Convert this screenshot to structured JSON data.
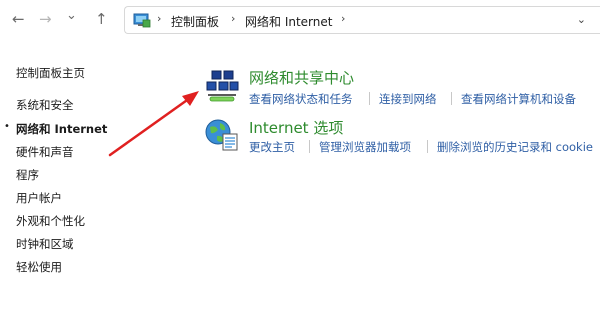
{
  "toolbar": {
    "back_icon": "←",
    "forward_icon": "→",
    "history_icon": "⌄",
    "up_icon": "↑"
  },
  "address_bar": {
    "crumbs": [
      "控制面板",
      "网络和 Internet"
    ],
    "separator": "›",
    "dropdown_icon": "⌄"
  },
  "sidebar": {
    "home": "控制面板主页",
    "items": [
      "系统和安全",
      "网络和 Internet",
      "硬件和声音",
      "程序",
      "用户帐户",
      "外观和个性化",
      "时钟和区域",
      "轻松使用"
    ],
    "active_index": 1,
    "bullet": "•"
  },
  "categories": [
    {
      "title": "网络和共享中心",
      "links": [
        "查看网络状态和任务",
        "连接到网络",
        "查看网络计算机和设备"
      ]
    },
    {
      "title": "Internet 选项",
      "links": [
        "更改主页",
        "管理浏览器加载项",
        "删除浏览的历史记录和 cookie"
      ]
    }
  ],
  "colors": {
    "title_green": "#2e8b2e",
    "link_blue": "#2f5fa5",
    "annotation_red": "#e02020"
  }
}
